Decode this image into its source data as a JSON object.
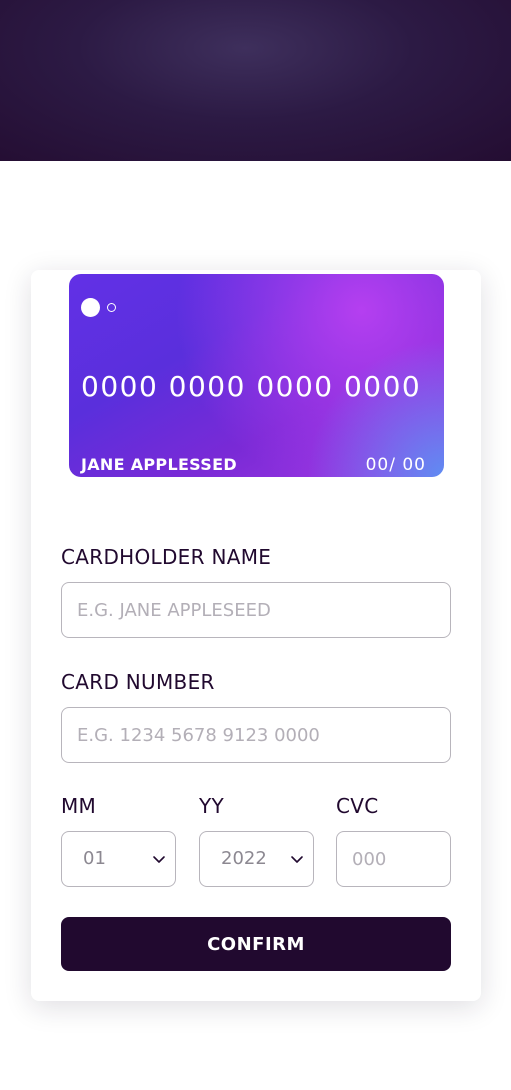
{
  "card": {
    "number": "0000 0000 0000 0000",
    "holder": "JANE APPLESSED",
    "expiry": "00/ 00"
  },
  "form": {
    "cardholder_label": "CARDHOLDER NAME",
    "cardholder_placeholder": "E.G. JANE APPLESEED",
    "number_label": "CARD NUMBER",
    "number_placeholder": "E.G. 1234 5678 9123 0000",
    "month_label": "MM",
    "month_value": "01",
    "year_label": "YY",
    "year_value": "2022",
    "cvc_label": "CVC",
    "cvc_placeholder": "000",
    "confirm_label": "CONFIRM"
  },
  "colors": {
    "dark_violet": "#21092f",
    "border_gray": "#b8b5bc",
    "placeholder_gray": "#b3afb7"
  },
  "icons": {
    "month_chevron": "chevron-down-icon",
    "year_chevron": "chevron-down-icon"
  }
}
